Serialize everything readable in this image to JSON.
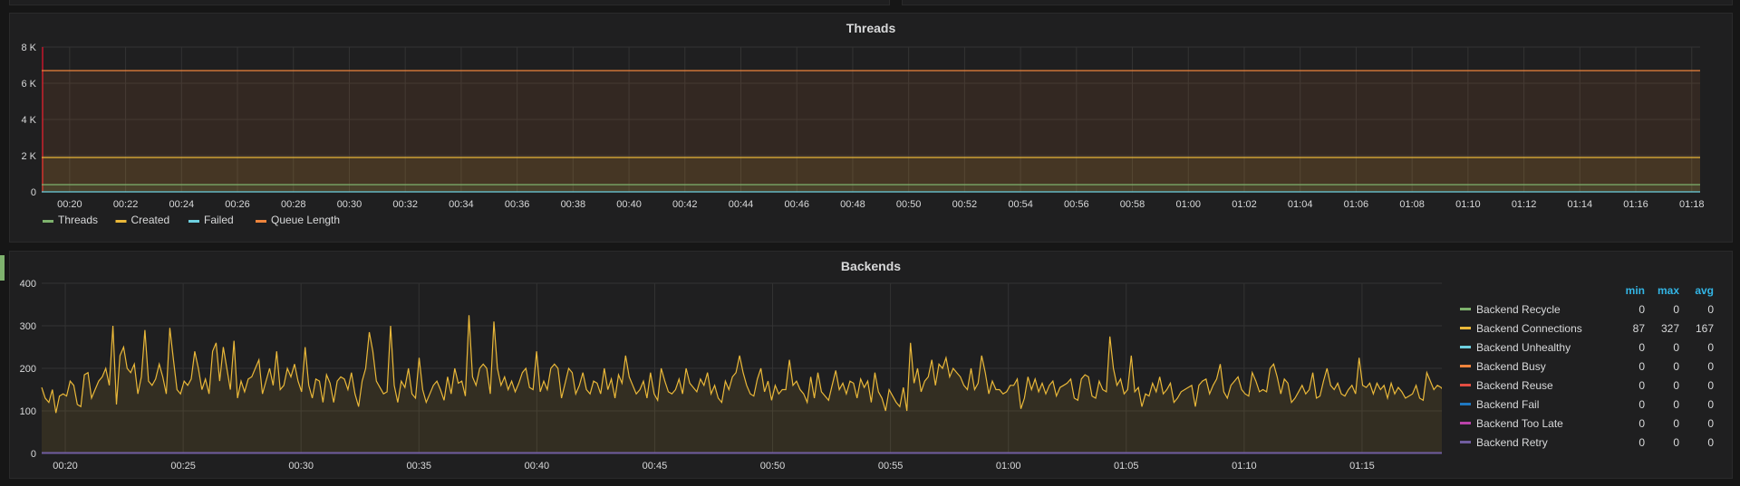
{
  "threads_panel": {
    "title": "Threads",
    "y_ticks": [
      "8 K",
      "6 K",
      "4 K",
      "2 K",
      "0"
    ],
    "x_ticks": [
      "00:20",
      "00:22",
      "00:24",
      "00:26",
      "00:28",
      "00:30",
      "00:32",
      "00:34",
      "00:36",
      "00:38",
      "00:40",
      "00:42",
      "00:44",
      "00:46",
      "00:48",
      "00:50",
      "00:52",
      "00:54",
      "00:56",
      "00:58",
      "01:00",
      "01:02",
      "01:04",
      "01:06",
      "01:08",
      "01:10",
      "01:12",
      "01:14",
      "01:16",
      "01:18"
    ],
    "legend": [
      {
        "label": "Threads",
        "color": "#7eb26d"
      },
      {
        "label": "Created",
        "color": "#eab839"
      },
      {
        "label": "Failed",
        "color": "#6ed0e0"
      },
      {
        "label": "Queue Length",
        "color": "#ef843c"
      }
    ]
  },
  "backends_panel": {
    "title": "Backends",
    "y_ticks": [
      "400",
      "300",
      "200",
      "100",
      "0"
    ],
    "x_ticks": [
      "00:20",
      "00:25",
      "00:30",
      "00:35",
      "00:40",
      "00:45",
      "00:50",
      "00:55",
      "01:00",
      "01:05",
      "01:10",
      "01:15"
    ],
    "legend_headers": {
      "min": "min",
      "max": "max",
      "avg": "avg"
    },
    "legend": [
      {
        "label": "Backend Recycle",
        "color": "#7eb26d",
        "min": "0",
        "max": "0",
        "avg": "0"
      },
      {
        "label": "Backend Connections",
        "color": "#eab839",
        "min": "87",
        "max": "327",
        "avg": "167"
      },
      {
        "label": "Backend Unhealthy",
        "color": "#6ed0e0",
        "min": "0",
        "max": "0",
        "avg": "0"
      },
      {
        "label": "Backend Busy",
        "color": "#ef843c",
        "min": "0",
        "max": "0",
        "avg": "0"
      },
      {
        "label": "Backend Reuse",
        "color": "#e24d42",
        "min": "0",
        "max": "0",
        "avg": "0"
      },
      {
        "label": "Backend Fail",
        "color": "#1f78c1",
        "min": "0",
        "max": "0",
        "avg": "0"
      },
      {
        "label": "Backend Too Late",
        "color": "#ba43a9",
        "min": "0",
        "max": "0",
        "avg": "0"
      },
      {
        "label": "Backend Retry",
        "color": "#705da0",
        "min": "0",
        "max": "0",
        "avg": "0"
      }
    ]
  },
  "chart_data": [
    {
      "type": "area",
      "title": "Threads",
      "ylim": [
        0,
        8000
      ],
      "x_range": [
        "00:19",
        "01:18"
      ],
      "grid": true,
      "legend_position": "bottom",
      "series": [
        {
          "name": "Threads",
          "color": "#7eb26d",
          "constant": 400
        },
        {
          "name": "Created",
          "color": "#eab839",
          "constant": 1900
        },
        {
          "name": "Failed",
          "color": "#6ed0e0",
          "constant": 0
        },
        {
          "name": "Queue Length",
          "color": "#ef843c",
          "constant": 6700
        }
      ]
    },
    {
      "type": "area",
      "title": "Backends",
      "ylim": [
        0,
        400
      ],
      "x_range": [
        "00:19",
        "01:18"
      ],
      "grid": true,
      "legend_position": "right",
      "series": [
        {
          "name": "Backend Connections",
          "color": "#eab839",
          "values": [
            155,
            130,
            120,
            150,
            95,
            135,
            140,
            135,
            170,
            160,
            115,
            110,
            185,
            190,
            130,
            150,
            170,
            180,
            200,
            160,
            300,
            115,
            230,
            250,
            200,
            190,
            210,
            140,
            180,
            290,
            170,
            160,
            175,
            210,
            180,
            140,
            295,
            220,
            150,
            140,
            170,
            160,
            175,
            240,
            200,
            150,
            175,
            140,
            240,
            260,
            170,
            250,
            200,
            150,
            265,
            130,
            170,
            145,
            175,
            180,
            200,
            220,
            140,
            170,
            200,
            160,
            240,
            150,
            160,
            200,
            180,
            210,
            170,
            145,
            250,
            160,
            130,
            175,
            170,
            120,
            185,
            165,
            120,
            170,
            180,
            175,
            150,
            190,
            140,
            110,
            170,
            200,
            285,
            240,
            170,
            155,
            140,
            145,
            300,
            160,
            120,
            170,
            155,
            200,
            140,
            130,
            225,
            150,
            120,
            140,
            160,
            170,
            150,
            125,
            180,
            140,
            200,
            165,
            170,
            135,
            325,
            180,
            160,
            200,
            210,
            200,
            140,
            310,
            200,
            160,
            180,
            150,
            170,
            145,
            165,
            190,
            200,
            155,
            150,
            240,
            145,
            170,
            150,
            200,
            210,
            200,
            130,
            165,
            200,
            190,
            140,
            160,
            190,
            150,
            140,
            170,
            165,
            140,
            200,
            150,
            175,
            130,
            185,
            165,
            230,
            180,
            160,
            140,
            150,
            170,
            130,
            190,
            140,
            125,
            200,
            170,
            145,
            140,
            150,
            175,
            140,
            200,
            165,
            155,
            145,
            175,
            160,
            190,
            140,
            160,
            130,
            120,
            170,
            150,
            180,
            190,
            230,
            190,
            160,
            140,
            135,
            175,
            200,
            145,
            170,
            125,
            160,
            140,
            150,
            150,
            220,
            160,
            170,
            150,
            140,
            120,
            180,
            130,
            190,
            145,
            135,
            125,
            160,
            195,
            150,
            165,
            140,
            170,
            165,
            130,
            175,
            155,
            170,
            120,
            190,
            145,
            130,
            100,
            150,
            135,
            120,
            110,
            155,
            100,
            260,
            165,
            200,
            145,
            170,
            180,
            220,
            160,
            210,
            200,
            225,
            180,
            200,
            190,
            180,
            160,
            150,
            200,
            150,
            165,
            230,
            190,
            140,
            170,
            150,
            150,
            140,
            145,
            160,
            160,
            175,
            105,
            130,
            180,
            150,
            175,
            145,
            165,
            140,
            160,
            170,
            135,
            155,
            160,
            165,
            175,
            130,
            125,
            175,
            185,
            180,
            135,
            130,
            170,
            150,
            145,
            275,
            200,
            160,
            175,
            140,
            150,
            230,
            145,
            155,
            110,
            140,
            135,
            165,
            145,
            180,
            140,
            150,
            165,
            120,
            130,
            145,
            150,
            155,
            160,
            110,
            160,
            170,
            175,
            140,
            160,
            175,
            210,
            145,
            130,
            160,
            170,
            180,
            150,
            140,
            135,
            190,
            170,
            145,
            150,
            145,
            200,
            210,
            180,
            140,
            175,
            165,
            120,
            130,
            145,
            160,
            140,
            150,
            190,
            130,
            135,
            170,
            200,
            160,
            150,
            165,
            140,
            135,
            150,
            160,
            140,
            225,
            160,
            155,
            165,
            140,
            165,
            150,
            160,
            130,
            165,
            140,
            155,
            145,
            130,
            135,
            140,
            160,
            130,
            125,
            190,
            170,
            150,
            160,
            155,
            145
          ]
        },
        {
          "name": "Backend Retry",
          "color": "#705da0",
          "constant": 0
        }
      ]
    }
  ]
}
